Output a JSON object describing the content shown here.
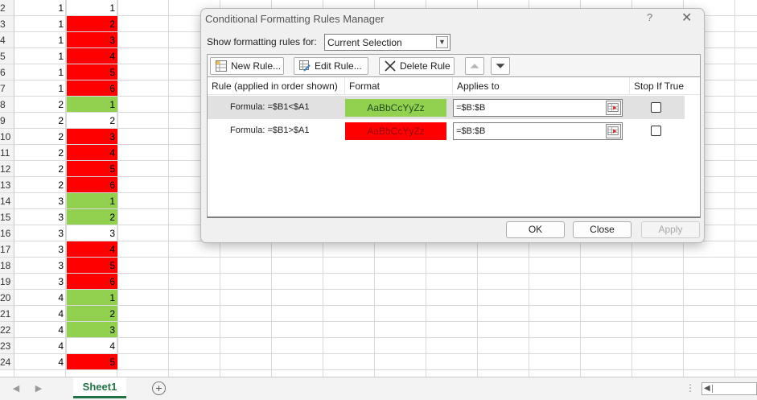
{
  "rows": [
    {
      "num": "2",
      "a": "1",
      "b": "1",
      "fill": ""
    },
    {
      "num": "3",
      "a": "1",
      "b": "2",
      "fill": "red"
    },
    {
      "num": "4",
      "a": "1",
      "b": "3",
      "fill": "red"
    },
    {
      "num": "5",
      "a": "1",
      "b": "4",
      "fill": "red"
    },
    {
      "num": "6",
      "a": "1",
      "b": "5",
      "fill": "red"
    },
    {
      "num": "7",
      "a": "1",
      "b": "6",
      "fill": "red"
    },
    {
      "num": "8",
      "a": "2",
      "b": "1",
      "fill": "green"
    },
    {
      "num": "9",
      "a": "2",
      "b": "2",
      "fill": ""
    },
    {
      "num": "10",
      "a": "2",
      "b": "3",
      "fill": "red"
    },
    {
      "num": "11",
      "a": "2",
      "b": "4",
      "fill": "red"
    },
    {
      "num": "12",
      "a": "2",
      "b": "5",
      "fill": "red"
    },
    {
      "num": "13",
      "a": "2",
      "b": "6",
      "fill": "red"
    },
    {
      "num": "14",
      "a": "3",
      "b": "1",
      "fill": "green"
    },
    {
      "num": "15",
      "a": "3",
      "b": "2",
      "fill": "green"
    },
    {
      "num": "16",
      "a": "3",
      "b": "3",
      "fill": ""
    },
    {
      "num": "17",
      "a": "3",
      "b": "4",
      "fill": "red"
    },
    {
      "num": "18",
      "a": "3",
      "b": "5",
      "fill": "red"
    },
    {
      "num": "19",
      "a": "3",
      "b": "6",
      "fill": "red"
    },
    {
      "num": "20",
      "a": "4",
      "b": "1",
      "fill": "green"
    },
    {
      "num": "21",
      "a": "4",
      "b": "2",
      "fill": "green"
    },
    {
      "num": "22",
      "a": "4",
      "b": "3",
      "fill": "green"
    },
    {
      "num": "23",
      "a": "4",
      "b": "4",
      "fill": ""
    },
    {
      "num": "24",
      "a": "4",
      "b": "5",
      "fill": "red"
    }
  ],
  "colors": {
    "red": "#ff0000",
    "green": "#92d050",
    "excel_green": "#217346"
  },
  "tabs": {
    "sheet1": "Sheet1",
    "add_icon": "plus-circle-icon"
  },
  "dialog": {
    "title": "Conditional Formatting Rules Manager",
    "help": "?",
    "close": "✕",
    "show_label": "Show formatting rules for:",
    "show_value": "Current Selection",
    "buttons": {
      "new_rule": "New Rule...",
      "edit_rule": "Edit Rule...",
      "delete_rule": "Delete Rule"
    },
    "columns": {
      "rule": "Rule (applied in order shown)",
      "format": "Format",
      "applies": "Applies to",
      "stop": "Stop If True"
    },
    "rules": [
      {
        "rule": "Formula: =$B1<$A1",
        "format": "AaBbCcYyZz",
        "applies": "=$B:$B",
        "stop": false
      },
      {
        "rule": "Formula: =$B1>$A1",
        "format": "AaBbCcYyZz",
        "applies": "=$B:$B",
        "stop": false
      }
    ],
    "ok": "OK",
    "close_btn": "Close",
    "apply": "Apply"
  }
}
